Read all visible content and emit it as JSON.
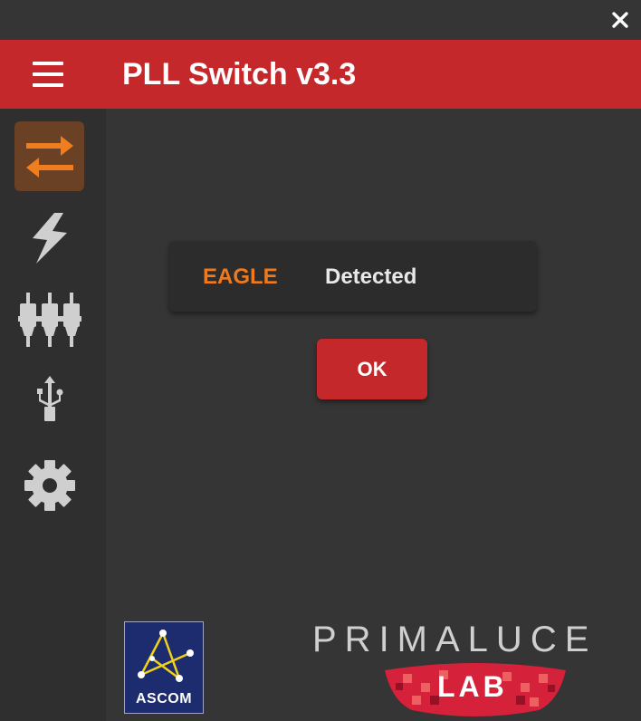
{
  "window": {
    "close_icon": "close-icon"
  },
  "header": {
    "title": "PLL Switch v3.3",
    "menu_icon": "hamburger-menu-icon",
    "accent_color": "#c5282a"
  },
  "sidebar": {
    "items": [
      {
        "id": "switch",
        "icon": "swap-arrows-icon",
        "active": true
      },
      {
        "id": "power",
        "icon": "lightning-bolt-icon",
        "active": false
      },
      {
        "id": "outputs",
        "icon": "power-connectors-icon",
        "active": false
      },
      {
        "id": "usb",
        "icon": "usb-icon",
        "active": false
      },
      {
        "id": "settings",
        "icon": "gear-icon",
        "active": false
      }
    ],
    "active_color": "#ef7a1e"
  },
  "status": {
    "device_name": "EAGLE",
    "state": "Detected",
    "device_color": "#ef7a1e"
  },
  "dialog": {
    "ok_label": "OK"
  },
  "footer": {
    "ascom_logo": "ASCOM",
    "brand_logo": "PRIMALUCE",
    "brand_sub": "LAB"
  }
}
